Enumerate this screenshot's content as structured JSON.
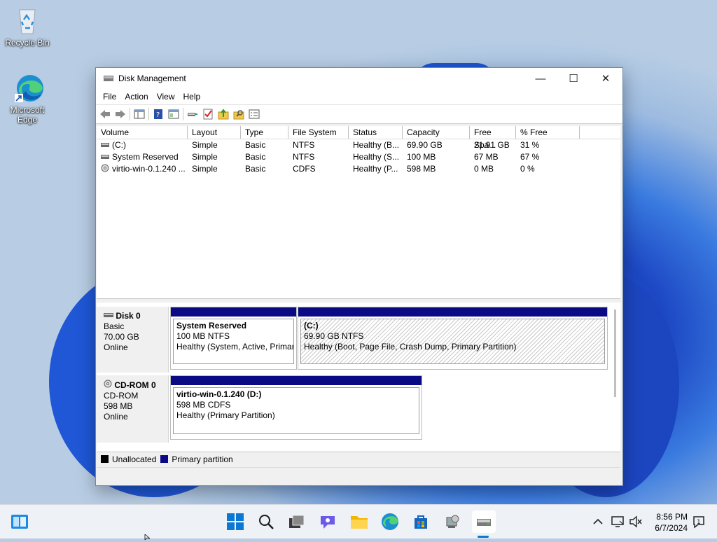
{
  "desktop": {
    "icons": [
      {
        "label": "Recycle Bin"
      },
      {
        "label": "Microsoft Edge"
      }
    ]
  },
  "window": {
    "title": "Disk Management",
    "menu": [
      "File",
      "Action",
      "View",
      "Help"
    ],
    "controls": {
      "minimize": "—",
      "maximize": "☐",
      "close": "✕"
    }
  },
  "volumes": {
    "columns": [
      "Volume",
      "Layout",
      "Type",
      "File System",
      "Status",
      "Capacity",
      "Free Spa...",
      "% Free"
    ],
    "rows": [
      [
        "(C:)",
        "Simple",
        "Basic",
        "NTFS",
        "Healthy (B...",
        "69.90 GB",
        "21.91 GB",
        "31 %"
      ],
      [
        "System Reserved",
        "Simple",
        "Basic",
        "NTFS",
        "Healthy (S...",
        "100 MB",
        "67 MB",
        "67 %"
      ],
      [
        "virtio-win-0.1.240 ...",
        "Simple",
        "Basic",
        "CDFS",
        "Healthy (P...",
        "598 MB",
        "0 MB",
        "0 %"
      ]
    ]
  },
  "disks": [
    {
      "name": "Disk 0",
      "type": "Basic",
      "size": "70.00 GB",
      "status": "Online",
      "partitions": [
        {
          "name": "System Reserved",
          "detail": "100 MB NTFS",
          "health": "Healthy (System, Active, Primar"
        },
        {
          "name": "(C:)",
          "detail": "69.90 GB NTFS",
          "health": "Healthy (Boot, Page File, Crash Dump, Primary Partition)"
        }
      ]
    },
    {
      "name": "CD-ROM 0",
      "type": "CD-ROM",
      "size": "598 MB",
      "status": "Online",
      "partitions": [
        {
          "name": "virtio-win-0.1.240  (D:)",
          "detail": "598 MB CDFS",
          "health": "Healthy (Primary Partition)"
        }
      ]
    }
  ],
  "legend": [
    {
      "label": "Unallocated",
      "color": "#000000"
    },
    {
      "label": "Primary partition",
      "color": "#0a0a84"
    }
  ],
  "taskbar": {
    "time": "8:56 PM",
    "date": "6/7/2024"
  }
}
